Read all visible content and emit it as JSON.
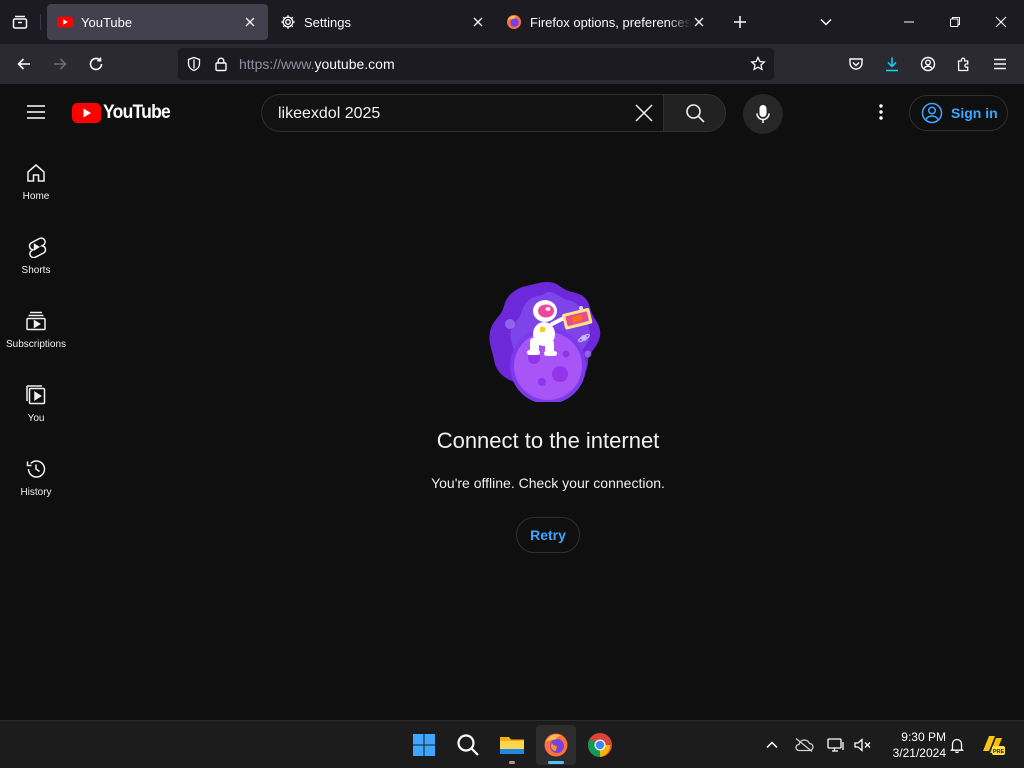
{
  "browser": {
    "tabs": [
      {
        "title": "YouTube",
        "active": true
      },
      {
        "title": "Settings",
        "active": false
      },
      {
        "title": "Firefox options, preferences and settings",
        "active": false
      }
    ],
    "url_scheme": "https://www.",
    "url_host": "youtube.com"
  },
  "youtube": {
    "logo_text": "YouTube",
    "search_query": "likeexdol 2025",
    "sign_in_label": "Sign in",
    "guide": [
      {
        "label": "Home",
        "icon": "home-icon"
      },
      {
        "label": "Shorts",
        "icon": "shorts-icon"
      },
      {
        "label": "Subscriptions",
        "icon": "subscriptions-icon"
      },
      {
        "label": "You",
        "icon": "you-icon"
      },
      {
        "label": "History",
        "icon": "history-icon"
      }
    ],
    "offline": {
      "title": "Connect to the internet",
      "message": "You're offline. Check your connection.",
      "retry_label": "Retry"
    }
  },
  "taskbar": {
    "apps": [
      "start-icon",
      "search-icon",
      "file-explorer-icon",
      "firefox-icon",
      "chrome-icon"
    ],
    "time": "9:30 PM",
    "date": "3/21/2024",
    "tray_badge": "PRE"
  },
  "colors": {
    "accent_blue": "#3ea6ff",
    "youtube_red": "#ff0000",
    "page_bg": "#0f0f0f",
    "illustration_purple": "#7c3aed"
  }
}
